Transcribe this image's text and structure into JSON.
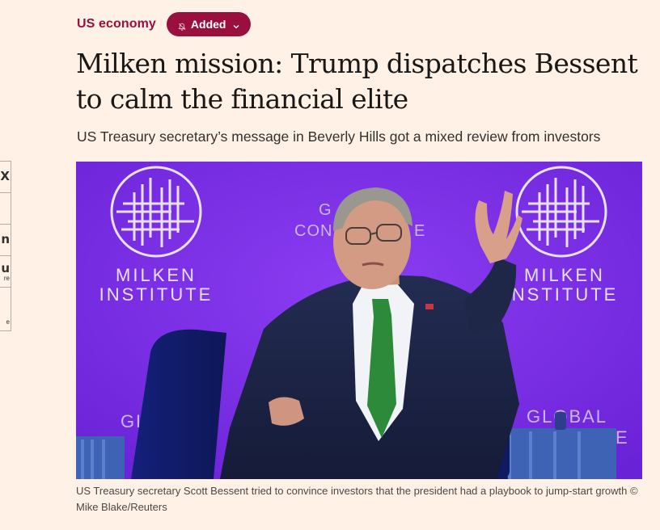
{
  "topic": {
    "label": "US economy"
  },
  "follow_button": {
    "label": "Added"
  },
  "headline": "Milken mission: Trump dispatches Bessent to calm the financial elite",
  "standfirst": "US Treasury secretary’s message in Beverly Hills got a mixed review from investors",
  "image": {
    "backdrop_left": {
      "org_line1": "MILKEN",
      "org_line2": "INSTITUTE",
      "bottom_text": "GLOBAL"
    },
    "backdrop_center": {
      "line1": "G",
      "line2": "CON",
      "line3": "E"
    },
    "backdrop_right": {
      "org_line1": "MILKEN",
      "org_line2": "INSTITUTE",
      "bottom_text": "GLOBAL",
      "bottom_fragment": "E"
    }
  },
  "caption": "US Treasury secretary Scott Bessent tried to convince investors that the president had a playbook to jump-start growth © Mike Blake/Reuters",
  "share_bar": {
    "items": [
      {
        "glyph": "X"
      },
      {
        "glyph": ""
      },
      {
        "glyph": "n"
      },
      {
        "glyph": "u",
        "sub": "re"
      },
      {
        "glyph": "",
        "sub": "e"
      }
    ]
  },
  "colors": {
    "background": "#FFF1E5",
    "accent": "#990F3D",
    "text": "#1A1817",
    "photo_backdrop": "#7A2BE0"
  },
  "icons": {
    "bell": "bell-off-icon",
    "chevron": "chevron-down-icon",
    "logo": "milken-institute-logo"
  }
}
